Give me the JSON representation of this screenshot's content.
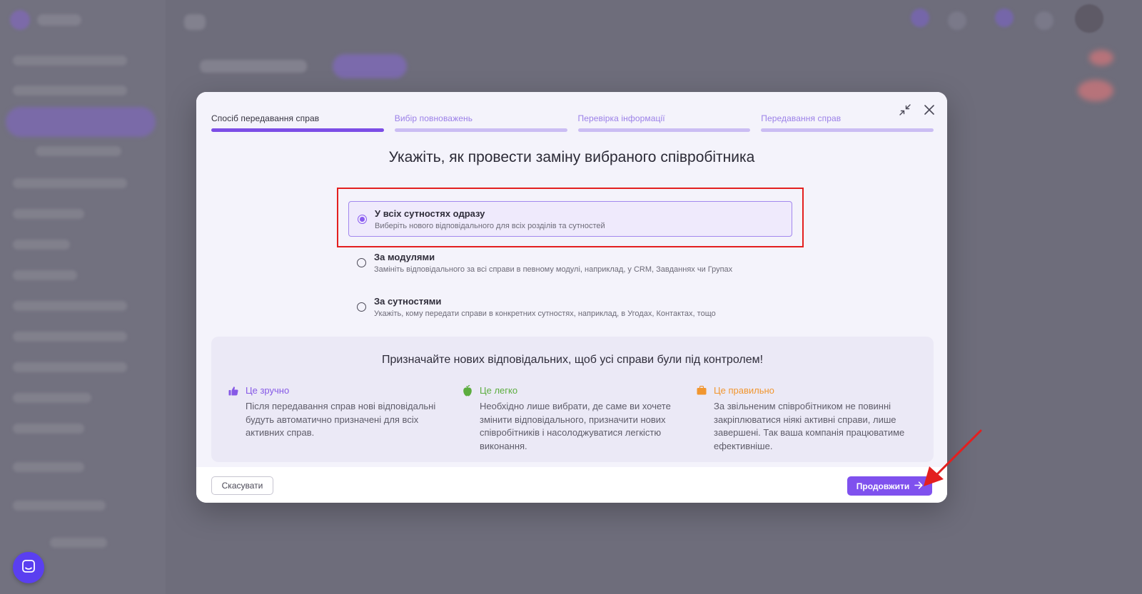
{
  "colors": {
    "accent": "#7f51ee",
    "step_active": "#7c4de6",
    "step_inactive": "#cbbdf3",
    "highlight": "#e31f1f",
    "convenient": "#8659e6",
    "easy": "#5cad3f",
    "correct": "#f1962f"
  },
  "steps": [
    {
      "label": "Спосіб передавання справ",
      "active": true
    },
    {
      "label": "Вибір повноважень",
      "active": false
    },
    {
      "label": "Перевірка інформації",
      "active": false
    },
    {
      "label": "Передавання справ",
      "active": false
    }
  ],
  "title": "Укажіть, як провести заміну вибраного співробітника",
  "options": [
    {
      "title": "У всіх сутностях одразу",
      "description": "Виберіть нового відповідального для всіх розділів та сутностей",
      "selected": true
    },
    {
      "title": "За модулями",
      "description": "Замініть відповідального за всі справи в певному модулі, наприклад, у CRM, Завданнях чи Групах",
      "selected": false
    },
    {
      "title": "За сутностями",
      "description": "Укажіть, кому передати справи в конкретних сутностях, наприклад, в Угодах, Контактах, тощо",
      "selected": false
    }
  ],
  "info": {
    "title": "Призначайте нових відповідальних, щоб усі справи були під контролем!",
    "columns": [
      {
        "icon": "thumbs-up-icon",
        "heading": "Це зручно",
        "text": "Після передавання справ нові відповідальні будуть автоматично призначені для всіх активних справ."
      },
      {
        "icon": "apple-icon",
        "heading": "Це легко",
        "text": "Необхідно лише вибрати, де саме ви хочете змінити відповідального, призначити нових співробітників і насолоджуватися легкістю виконання."
      },
      {
        "icon": "briefcase-icon",
        "heading": "Це правильно",
        "text": "За звільненим співробітником не повинні закріплюватися ніякі активні справи, лише завершені. Так ваша компанія працюватиме ефективніше."
      }
    ]
  },
  "footer": {
    "cancel_label": "Скасувати",
    "continue_label": "Продовжити"
  }
}
